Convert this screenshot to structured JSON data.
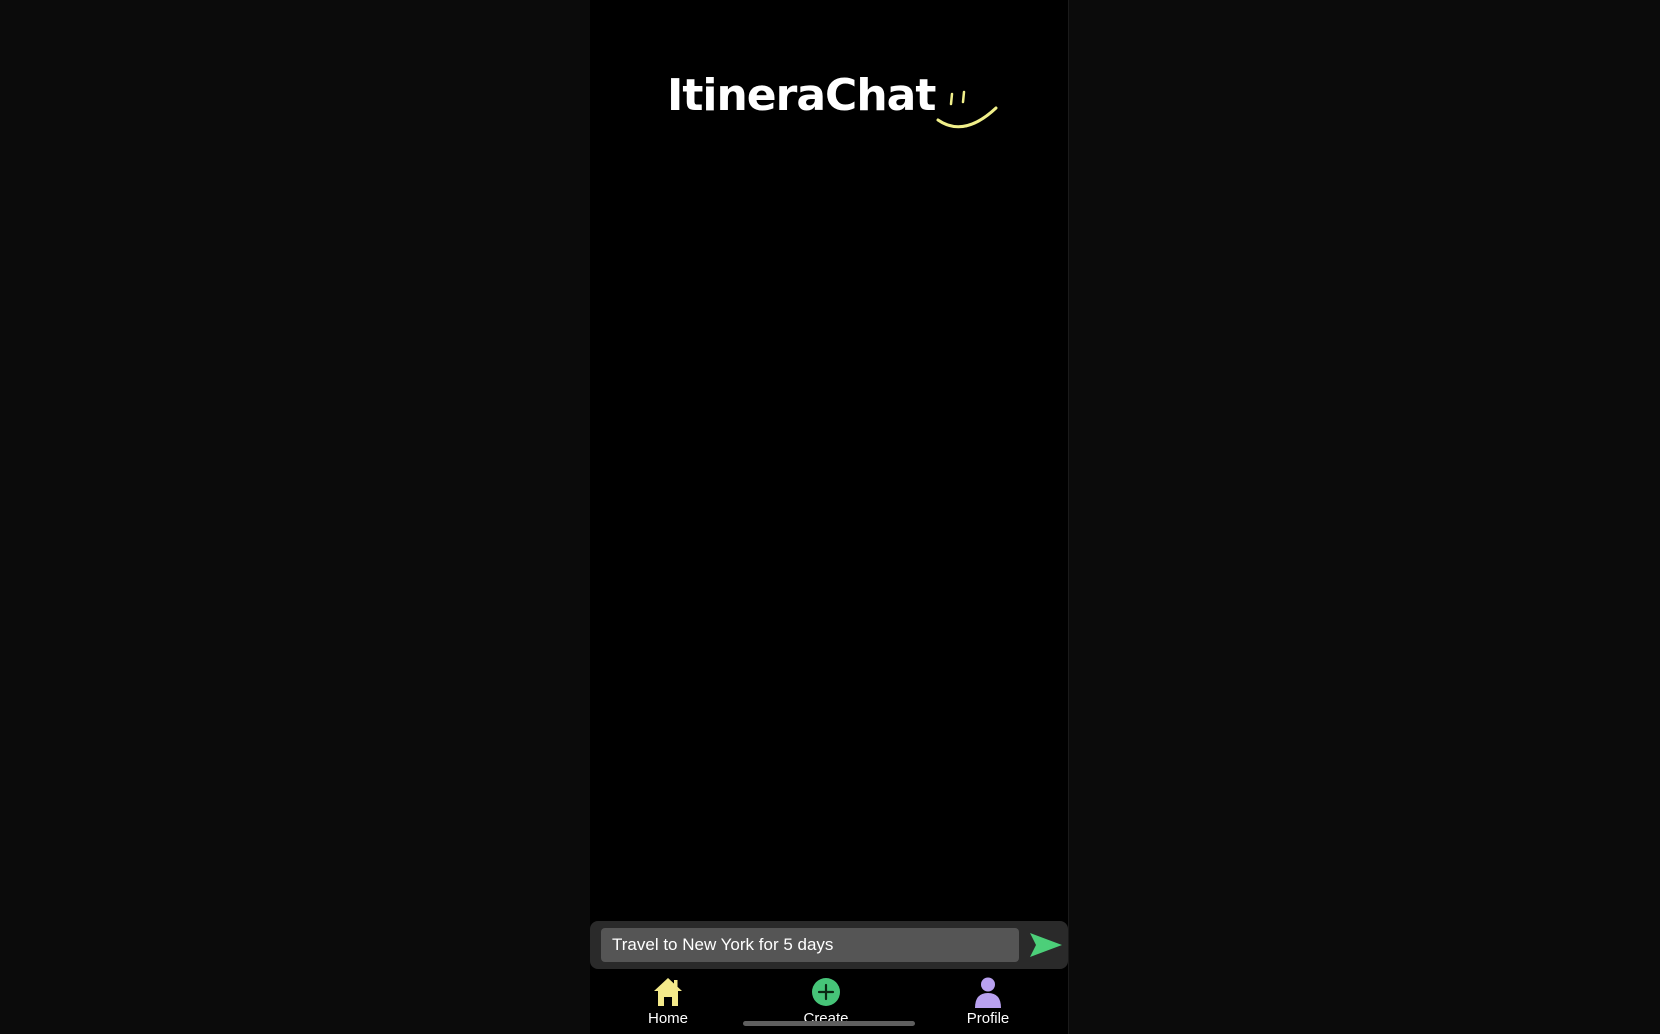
{
  "app": {
    "title": "ItineraChat",
    "logo_icon": "smile-icon",
    "accent_color": "#f1f08a"
  },
  "composer": {
    "input_value": "Travel to New York for 5 days",
    "send_icon": "send-icon",
    "send_color": "#4ccf79"
  },
  "tabbar": {
    "items": [
      {
        "label": "Home",
        "icon": "home-icon",
        "color": "#f4ea8a"
      },
      {
        "label": "Create",
        "icon": "plus-circle-icon",
        "color": "#46c478"
      },
      {
        "label": "Profile",
        "icon": "person-icon",
        "color": "#b9a1f0"
      }
    ]
  }
}
